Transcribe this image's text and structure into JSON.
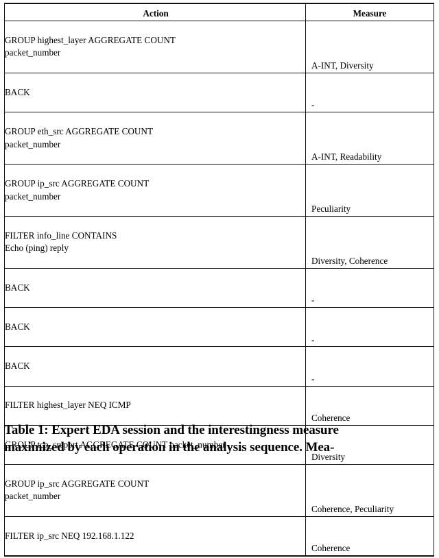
{
  "table": {
    "columns": [
      {
        "key": "action",
        "label": "Action",
        "align": "left"
      },
      {
        "key": "measure",
        "label": "Measure",
        "align": "right"
      }
    ],
    "rows": [
      {
        "action_lines": [
          "GROUP highest_layer AGGREGATE COUNT",
          "packet_number"
        ],
        "action": "GROUP highest_layer AGGREGATE COUNT packet_number",
        "measure": "A-INT, Diversity"
      },
      {
        "action_lines": [
          "BACK"
        ],
        "action": "BACK",
        "measure": "-"
      },
      {
        "action_lines": [
          "GROUP eth_src AGGREGATE COUNT",
          "packet_number"
        ],
        "action": "GROUP eth_src AGGREGATE COUNT packet_number",
        "measure": "A-INT, Readability"
      },
      {
        "action_lines": [
          "GROUP ip_src AGGREGATE COUNT",
          "packet_number"
        ],
        "action": "GROUP ip_src AGGREGATE COUNT packet_number",
        "measure": "Peculiarity"
      },
      {
        "action_lines": [
          "FILTER info_line CONTAINS",
          "Echo (ping) reply"
        ],
        "action": "FILTER info_line CONTAINS Echo (ping) reply",
        "measure": "Diversity, Coherence"
      },
      {
        "action_lines": [
          "BACK"
        ],
        "action": "BACK",
        "measure": "-"
      },
      {
        "action_lines": [
          "BACK"
        ],
        "action": "BACK",
        "measure": "-"
      },
      {
        "action_lines": [
          "BACK"
        ],
        "action": "BACK",
        "measure": "-"
      },
      {
        "action_lines": [
          "FILTER highest_layer NEQ ICMP"
        ],
        "action": "FILTER highest_layer NEQ ICMP",
        "measure": "Coherence"
      },
      {
        "action_lines": [
          "GROUP tcp_srcport AGGREGATE COUNT packet_number"
        ],
        "action": "GROUP tcp_srcport AGGREGATE COUNT packet_number",
        "measure": "Diversity"
      },
      {
        "action_lines": [
          "GROUP ip_src AGGREGATE COUNT",
          "packet_number"
        ],
        "action": "GROUP ip_src AGGREGATE COUNT packet_number",
        "measure": "Coherence, Peculiarity"
      },
      {
        "action_lines": [
          "FILTER ip_src NEQ 192.168.1.122"
        ],
        "action": "FILTER ip_src NEQ 192.168.1.122",
        "measure": "Coherence"
      }
    ]
  },
  "caption": {
    "lines": [
      "Table 1: Expert EDA session and the interestingness measure",
      "maximized by each operation in the analysis sequence. Mea-"
    ],
    "text": "Table 1: Expert EDA session and the interestingness measure maximized by each operation in the analysis sequence. Mea-"
  }
}
